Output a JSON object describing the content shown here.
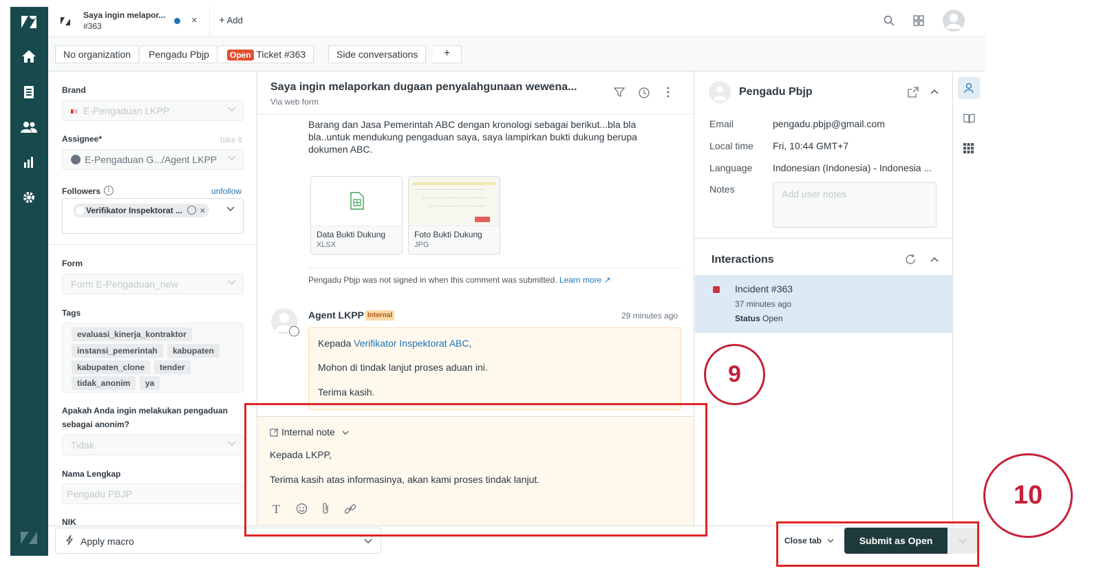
{
  "tabs": {
    "active": {
      "title": "Saya ingin melapor...",
      "subtitle": "#363"
    },
    "add_label": "Add"
  },
  "breadcrumbs": {
    "organization": "No organization",
    "requester": "Pengadu Pbjp",
    "status_badge": "Open",
    "ticket": "Ticket #363",
    "side_conversations": "Side conversations",
    "plus": "+"
  },
  "ticket_fields": {
    "brand_label": "Brand",
    "brand_value": "E-Pengaduan LKPP",
    "assignee_label": "Assignee*",
    "take_it": "take it",
    "assignee_value": "E-Pengaduan G.../Agent LKPP",
    "followers_label": "Followers",
    "unfollow": "unfollow",
    "follower_chip": "Verifikator Inspektorat ...",
    "form_label": "Form",
    "form_value": "Form E-Pengaduan_new",
    "tags_label": "Tags",
    "tags": [
      "evaluasi_kinerja_kontraktor",
      "instansi_pemerintah",
      "kabupaten",
      "kabupaten_clone",
      "tender",
      "tidak_anonim",
      "ya"
    ],
    "anon_label_1": "Apakah Anda ingin melakukan pengaduan",
    "anon_label_2": "sebagai anonim?",
    "anon_value": "Tidak",
    "name_label": "Nama Lengkap",
    "name_value": "Pengadu PBJP",
    "nik_label": "NIK"
  },
  "conversation": {
    "title": "Saya ingin melaporkan dugaan penyalahgunaan wewena...",
    "via": "Via web form",
    "body_lines": [
      "Barang dan Jasa Pemerintah ABC dengan kronologi sebagai berikut...bla bla",
      "bla..untuk mendukung pengaduan saya, saya lampirkan bukti dukung berupa",
      "dokumen ABC."
    ],
    "attachments": [
      {
        "name": "Data Bukti Dukung",
        "type": "XLSX"
      },
      {
        "name": "Foto Bukti Dukung",
        "type": "JPG"
      }
    ],
    "not_signed": "Pengadu Pbjp was not signed in when this comment was submitted.",
    "learn_more": "Learn more",
    "agent_name": "Agent LKPP",
    "internal_badge": "Internal",
    "agent_time": "29 minutes ago",
    "note_greeting": "Kepada",
    "note_mention": "Verifikator Inspektorat ABC",
    "note_comma": ",",
    "note_line2": "Mohon di tindak lanjut proses aduan ini.",
    "note_line3": "Terima kasih."
  },
  "composer": {
    "mode": "Internal note",
    "line1": "Kepada LKPP,",
    "line2": "Terima kasih atas informasinya, akan kami proses tindak lanjut."
  },
  "user_panel": {
    "name": "Pengadu Pbjp",
    "email_label": "Email",
    "email": "pengadu.pbjp@gmail.com",
    "localtime_label": "Local time",
    "localtime": "Fri, 10:44 GMT+7",
    "language_label": "Language",
    "language": "Indonesian (Indonesia) - Indonesia ...",
    "notes_label": "Notes",
    "notes_placeholder": "Add user notes",
    "interactions_title": "Interactions",
    "incident_title": "Incident #363",
    "incident_time": "37 minutes ago",
    "status_label": "Status",
    "status_value": "Open"
  },
  "bottom": {
    "apply_macro": "Apply macro",
    "close_tab": "Close tab",
    "submit": "Submit as Open"
  },
  "annotations": {
    "step9": "9",
    "step10": "10"
  },
  "colors": {
    "nav_bg": "#17494d",
    "open_badge": "#e34f32",
    "internal_badge": "#fcdba9",
    "internal_bg": "#fff8ed",
    "submit_bg": "#1f3a3d",
    "link": "#1f73b7",
    "annotation_red": "#e02424",
    "circle_red": "#c4213b",
    "interaction_bg": "#dde9f4"
  }
}
